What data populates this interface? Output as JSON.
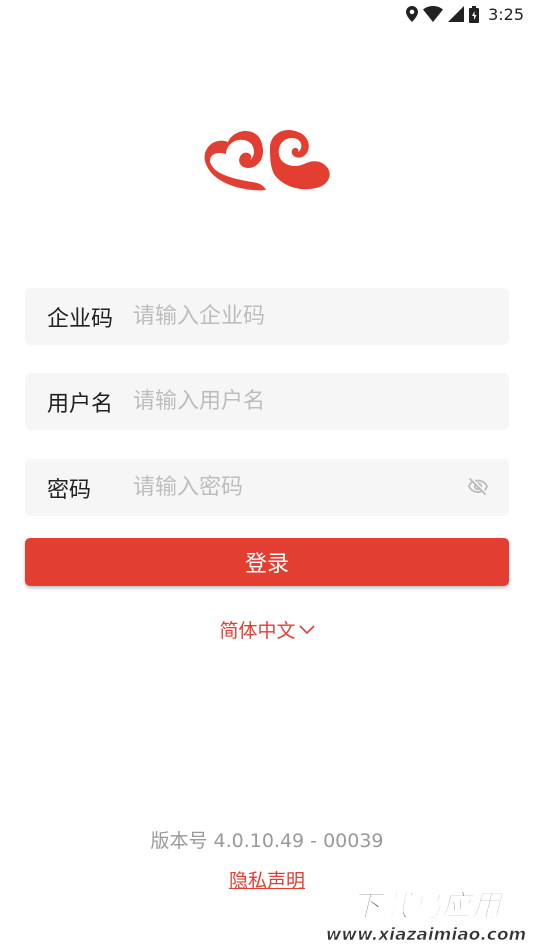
{
  "status_bar": {
    "time": "3:25",
    "icons": [
      "location-icon",
      "wifi-icon",
      "signal-icon",
      "battery-icon"
    ]
  },
  "logo": {
    "name": "cloud-logo",
    "color": "#e33e32"
  },
  "form": {
    "company": {
      "label": "企业码",
      "placeholder": "请输入企业码",
      "value": ""
    },
    "username": {
      "label": "用户名",
      "placeholder": "请输入用户名",
      "value": ""
    },
    "password": {
      "label": "密码",
      "placeholder": "请输入密码",
      "value": "",
      "visibility_icon": "eye-off-icon"
    }
  },
  "login_button": {
    "label": "登录"
  },
  "language": {
    "selected": "简体中文",
    "icon": "chevron-down-icon"
  },
  "footer": {
    "version": "版本号 4.0.10.49 - 00039",
    "privacy_link": "隐私声明"
  },
  "watermark": {
    "line1": "下载乌应用",
    "line2": "www.xiazaimiao.com"
  },
  "colors": {
    "accent": "#e33e32",
    "field_bg": "#f6f6f6",
    "placeholder": "#bdbdbd",
    "muted_text": "#9a9a9a"
  }
}
